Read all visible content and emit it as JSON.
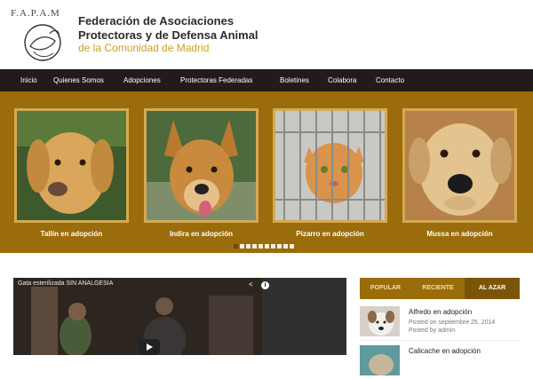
{
  "header": {
    "logo_letters": "F.A.P.A.M",
    "title_line1": "Federación de Asociaciones",
    "title_line2": "Protectoras y de Defensa Animal",
    "subtitle": "de la Comunidad de Madrid"
  },
  "nav": {
    "items": [
      {
        "label": "Inicio"
      },
      {
        "label": "Quienes Somos"
      },
      {
        "label": "Adopciones"
      },
      {
        "label": "Protectoras Federadas"
      },
      {
        "label": "Boletines"
      },
      {
        "label": "Colabora"
      },
      {
        "label": "Contacto"
      }
    ]
  },
  "carousel": {
    "slides": [
      {
        "caption": "Tallín en adopción",
        "icon": "golden-dog-photo"
      },
      {
        "caption": "Indira en adopción",
        "icon": "shepherd-dog-photo"
      },
      {
        "caption": "Pizarro en adopción",
        "icon": "orange-cat-photo"
      },
      {
        "caption": "Mussa en adopción",
        "icon": "yellow-dog-photo"
      }
    ],
    "page_count": 10,
    "active_page": 1
  },
  "video": {
    "title": "Gata esterilizada SIN ANALGESIA",
    "share_glyph": "<",
    "info_glyph": "i"
  },
  "sidebar": {
    "tabs": [
      {
        "label": "POPULAR"
      },
      {
        "label": "RECIENTE"
      },
      {
        "label": "AL AZAR"
      }
    ],
    "posts": [
      {
        "title": "Alfredo en adopción",
        "date": "Posted on septiembre 25, 2014",
        "author": "Posted by admin"
      },
      {
        "title": "Calicache en adopción"
      }
    ]
  },
  "colors": {
    "nav_bg": "#231a1c",
    "carousel_bg": "#9b6c0b",
    "accent_gold": "#c9a02a",
    "tab_active": "#7b5507"
  }
}
